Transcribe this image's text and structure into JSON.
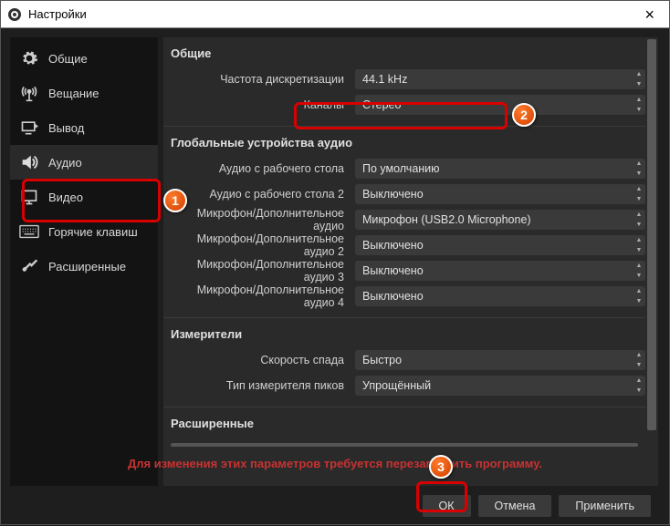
{
  "title": "Настройки",
  "sidebar": {
    "items": [
      {
        "label": "Общие"
      },
      {
        "label": "Вещание"
      },
      {
        "label": "Вывод"
      },
      {
        "label": "Аудио"
      },
      {
        "label": "Видео"
      },
      {
        "label": "Горячие клавиш"
      },
      {
        "label": "Расширенные"
      }
    ]
  },
  "sections": {
    "general": {
      "title": "Общие",
      "sample_rate": {
        "label": "Частота дискретизации",
        "value": "44.1 kHz"
      },
      "channels": {
        "label": "Каналы",
        "value": "Стерео"
      }
    },
    "devices": {
      "title": "Глобальные устройства аудио",
      "rows": [
        {
          "label": "Аудио с рабочего стола",
          "value": "По умолчанию"
        },
        {
          "label": "Аудио с рабочего стола 2",
          "value": "Выключено"
        },
        {
          "label": "Микрофон/Дополнительное аудио",
          "value": "Микрофон (USB2.0 Microphone)"
        },
        {
          "label": "Микрофон/Дополнительное аудио 2",
          "value": "Выключено"
        },
        {
          "label": "Микрофон/Дополнительное аудио 3",
          "value": "Выключено"
        },
        {
          "label": "Микрофон/Дополнительное аудио 4",
          "value": "Выключено"
        }
      ]
    },
    "meters": {
      "title": "Измерители",
      "decay": {
        "label": "Скорость спада",
        "value": "Быстро"
      },
      "peak": {
        "label": "Тип измерителя пиков",
        "value": "Упрощённый"
      }
    },
    "advanced": {
      "title": "Расширенные"
    }
  },
  "warning": "Для изменения этих параметров требуется перезапустить программу.",
  "buttons": {
    "ok": "ОК",
    "cancel": "Отмена",
    "apply": "Применить"
  }
}
